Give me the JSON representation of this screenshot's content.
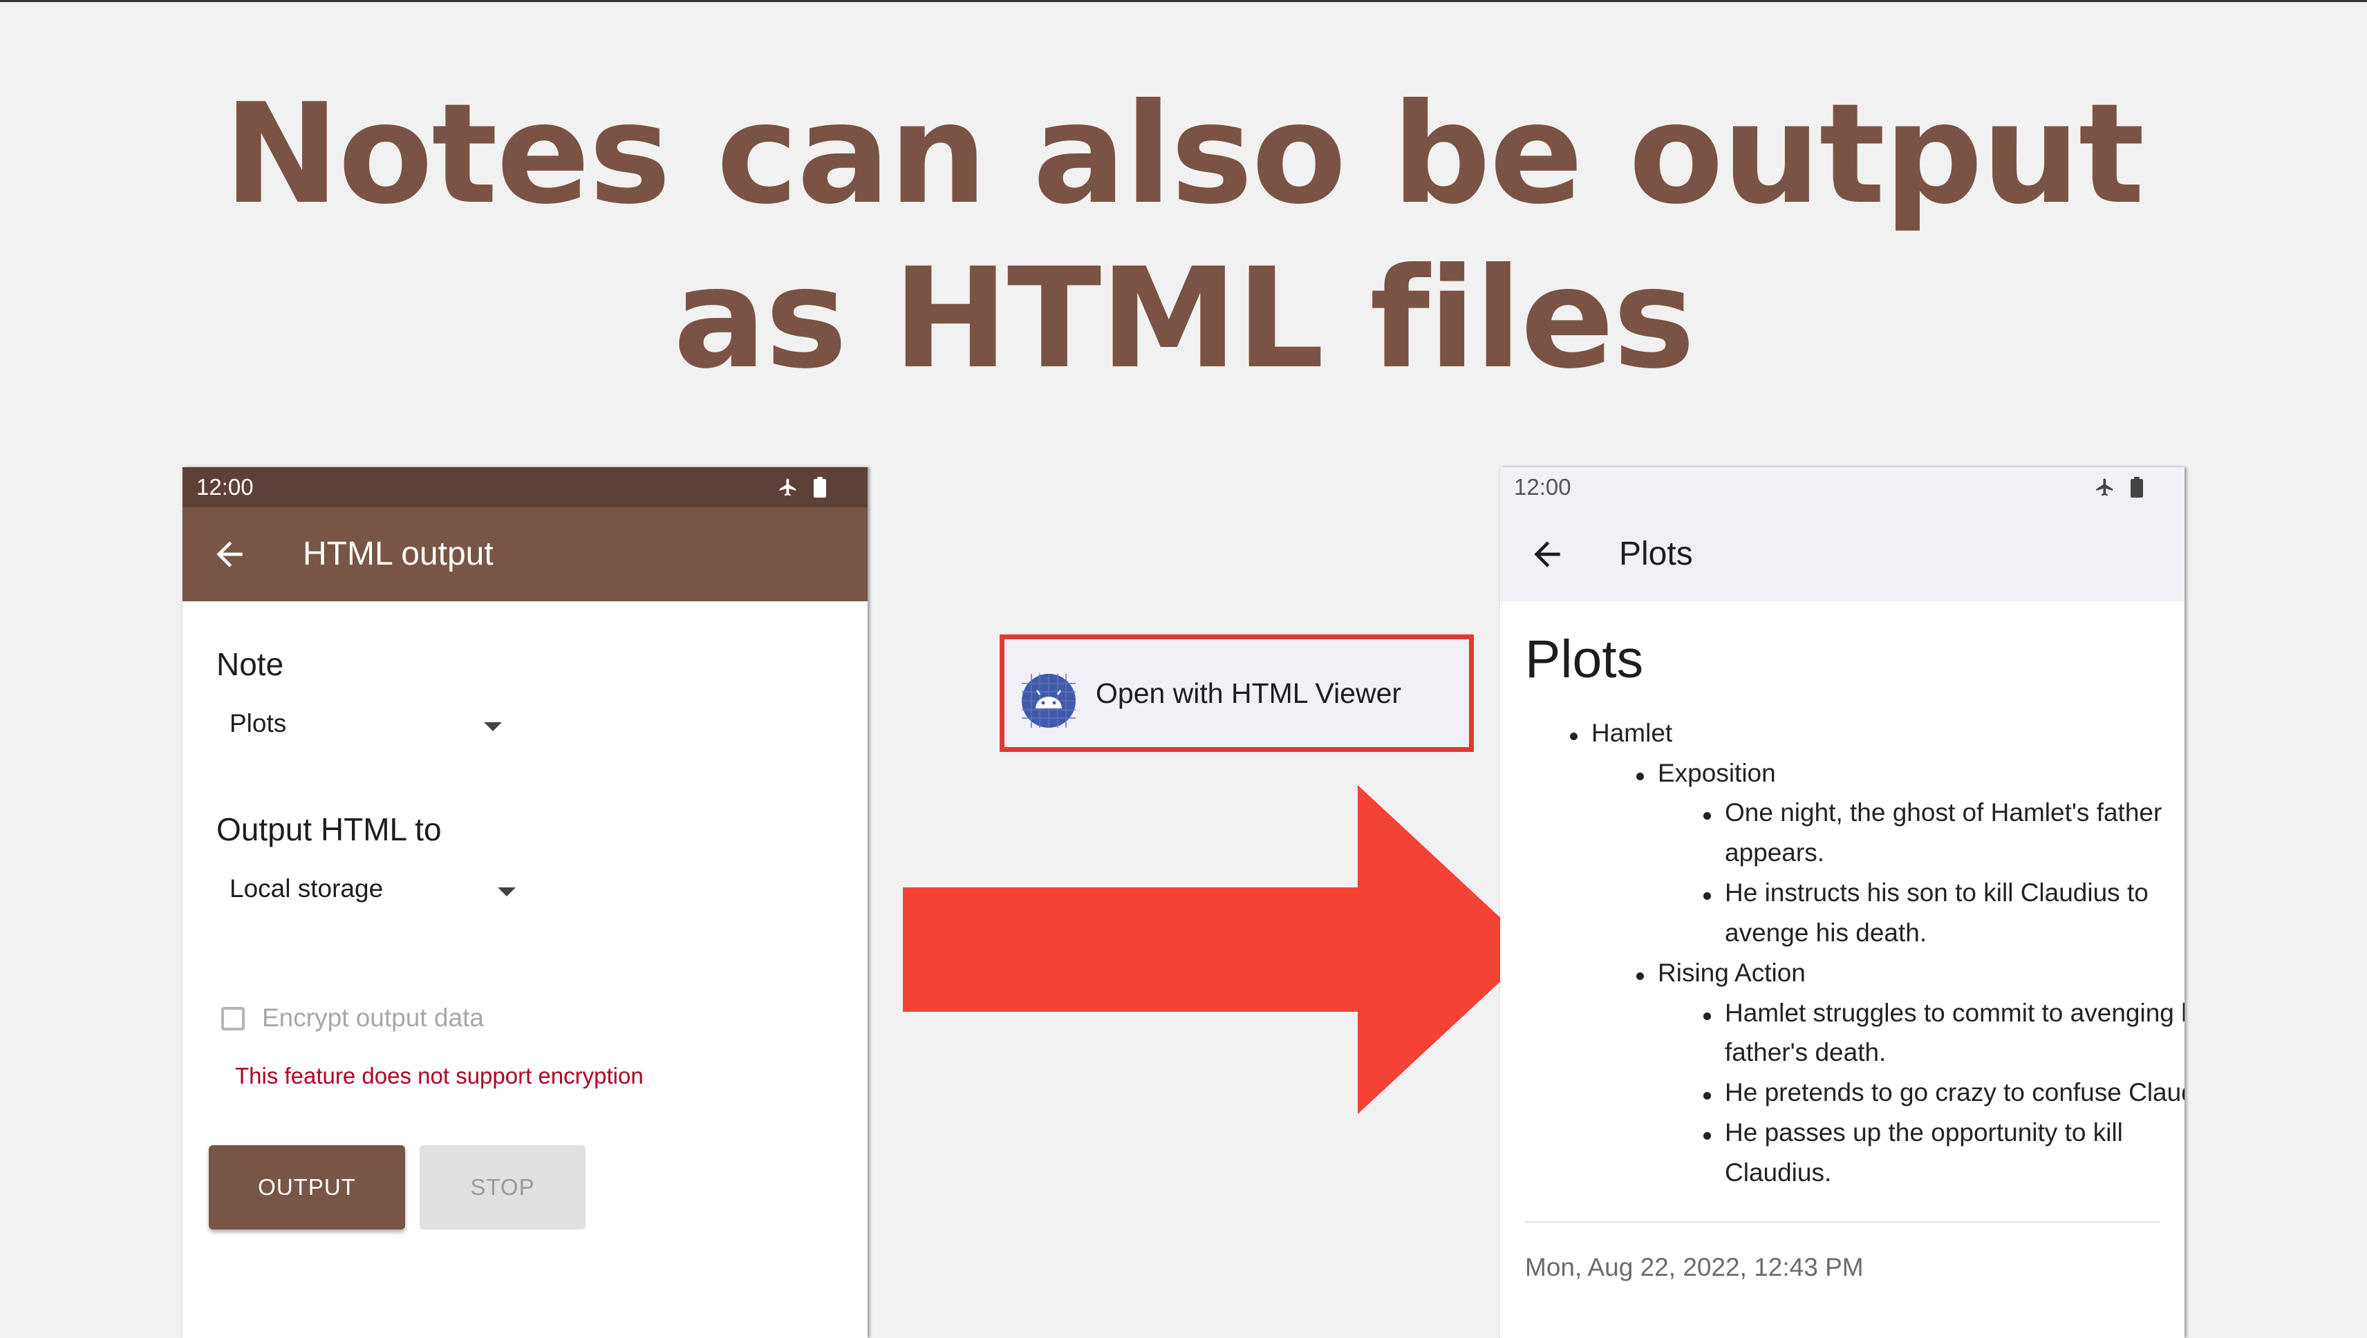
{
  "headline": {
    "line1": "Notes can also be output",
    "line2": "as HTML files"
  },
  "left_phone": {
    "status_time": "12:00",
    "appbar_title": "HTML output",
    "note_label": "Note",
    "note_value": "Plots",
    "output_to_label": "Output HTML to",
    "output_to_value": "Local storage",
    "encrypt_label": "Encrypt output data",
    "encrypt_checked": false,
    "error_text": "This feature does not support encryption",
    "output_button": "OUTPUT",
    "stop_button": "STOP"
  },
  "chooser": {
    "label": "Open with HTML Viewer",
    "icon": "android-icon"
  },
  "right_phone": {
    "status_time": "12:00",
    "appbar_title": "Plots",
    "doc_title": "Plots",
    "lines": [
      "Hamlet",
      "Exposition",
      "One night, the ghost of Hamlet's father",
      "appears.",
      "He instructs his son to kill Claudius to",
      "avenge his death.",
      "Rising Action",
      "Hamlet struggles to commit to avenging his",
      "father's death.",
      "He pretends to go crazy to confuse Claudius.",
      "He passes up the opportunity to kill",
      "Claudius."
    ],
    "date": "Mon, Aug 22, 2022, 12:43 PM"
  },
  "colors": {
    "brand_brown": "#795548",
    "status_brown": "#5d4037",
    "headline": "#7a5344",
    "arrow_red": "#f44336",
    "highlight_red": "#e03a33",
    "error_red": "#b00020"
  }
}
